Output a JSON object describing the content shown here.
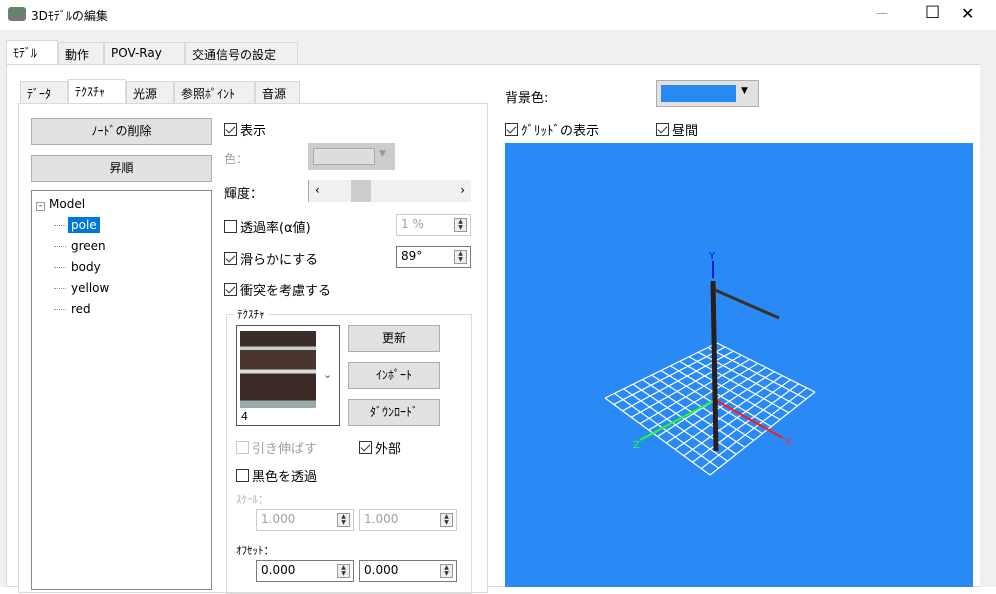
{
  "window": {
    "title": "3Dﾓﾃﾞﾙの編集",
    "minimize": "—",
    "maximize": "☐",
    "close": "✕"
  },
  "main_tabs": [
    "ﾓﾃﾞﾙ",
    "動作",
    "POV-Ray",
    "交通信号の設定"
  ],
  "sub_tabs": [
    "ﾃﾞｰﾀ",
    "ﾃｸｽﾁｬ",
    "光源",
    "参照ﾎﾟｲﾝﾄ",
    "音源"
  ],
  "buttons": {
    "delete_node": "ﾉｰﾄﾞの削除",
    "sort_asc": "昇順",
    "update": "更新",
    "import": "ｲﾝﾎﾟｰﾄ",
    "download": "ﾀﾞｳﾝﾛｰﾄﾞ"
  },
  "tree": {
    "root": "Model",
    "children": [
      "pole",
      "green",
      "body",
      "yellow",
      "red"
    ],
    "selected": "pole"
  },
  "props": {
    "show": "表示",
    "color": "色：",
    "brightness": "輝度：",
    "brightness_value": 0.15,
    "transparency": "透過率(α値)",
    "transparency_value": "1 %",
    "smooth": "滑らかにする",
    "smooth_value": "89°",
    "collision": "衝突を考慮する"
  },
  "texture": {
    "group": "ﾃｸｽﾁｬ",
    "index": "4",
    "stretch": "引き伸ばす",
    "external": "外部",
    "black_transparent": "黒色を透過",
    "scale_label": "ｽｹｰﾙ：",
    "scale_x": "1.000",
    "scale_y": "1.000",
    "offset_label": "ｵﾌｾｯﾄ：",
    "offset_x": "0.000",
    "offset_y": "0.000"
  },
  "view": {
    "bg_label": "背景色:",
    "bg_color": "#2a8af5",
    "grid": "ｸﾞﾘｯﾄﾞの表示",
    "daytime": "昼間",
    "axis_x": "X",
    "axis_y": "Y",
    "axis_z": "Z"
  }
}
